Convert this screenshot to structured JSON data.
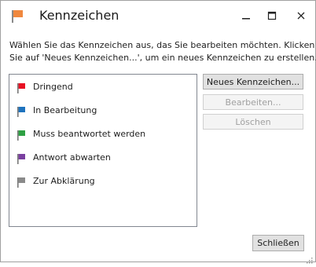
{
  "window": {
    "title": "Kennzeichen",
    "title_icon": "orange-flag-icon",
    "controls": {
      "minimize_icon": "minimize-icon",
      "maximize_icon": "maximize-icon",
      "close_icon": "close-icon"
    }
  },
  "instruction": {
    "line1": "Wählen Sie das Kennzeichen aus, das Sie bearbeiten möchten. Klicken",
    "line2": "Sie auf 'Neues Kennzeichen...', um ein neues Kennzeichen zu erstellen."
  },
  "flags": [
    {
      "label": "Dringend",
      "color": "#e81123"
    },
    {
      "label": "In Bearbeitung",
      "color": "#1e73be"
    },
    {
      "label": "Muss beantwortet werden",
      "color": "#2ea043"
    },
    {
      "label": "Antwort abwarten",
      "color": "#7a3fa0"
    },
    {
      "label": "Zur Abklärung",
      "color": "#8a8a8a"
    }
  ],
  "buttons": {
    "new_label": "Neues Kennzeichen...",
    "edit_label": "Bearbeiten...",
    "delete_label": "Löschen",
    "close_label": "Schließen"
  },
  "colors": {
    "title_flag": "#f0883e"
  }
}
